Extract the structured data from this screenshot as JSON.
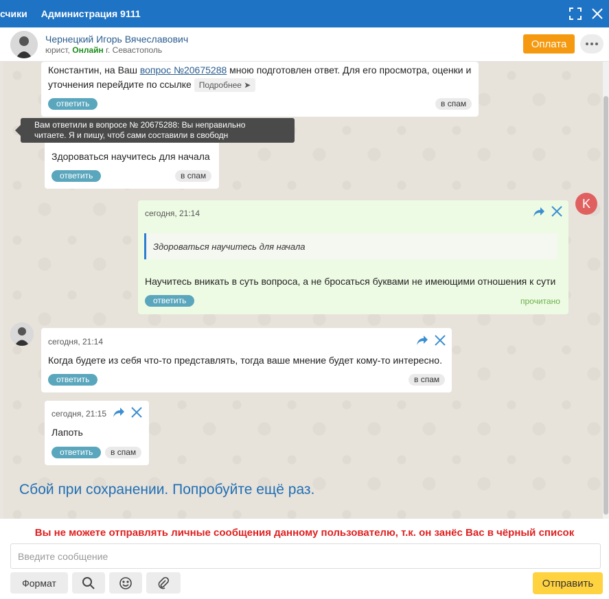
{
  "window": {
    "tabs": [
      "счики",
      "Администрация 9111"
    ]
  },
  "header": {
    "user_name": "Чернецкий Игорь Вячеславович",
    "role": "юрист,",
    "status": "Онлайн",
    "city": "г. Севастополь",
    "pay_label": "Оплата"
  },
  "messages": {
    "m1": {
      "text_before": "Константин, на Ваш ",
      "link": "вопрос №20675288",
      "text_after": " мною подготовлен ответ. Для его просмотра, оценки и уточнения перейдите по ссылке ",
      "more": "Подробнее ➤",
      "reply": "ответить",
      "spam": "в спам"
    },
    "tooltip": {
      "line1": "Вам ответили в вопросе № 20675288: Вы неправильно",
      "line2": "читаете. Я и пишу, чтоб сами составили в свободн"
    },
    "m2": {
      "text": "Здороваться научитесь для начала",
      "reply": "ответить",
      "spam": "в спам"
    },
    "m3": {
      "time": "сегодня, 21:14",
      "quote": "Здороваться научитесь для начала",
      "text": "Научитесь вникать в суть вопроса, а не бросаться буквами не имеющими отношения к сути",
      "reply": "ответить",
      "read": "прочитано",
      "avatar_letter": "K"
    },
    "m4": {
      "time": "сегодня, 21:14",
      "text": "Когда будете из себя что-то представлять, тогда ваше мнение будет кому-то интересно.",
      "reply": "ответить",
      "spam": "в спам"
    },
    "m5": {
      "time": "сегодня, 21:15",
      "text": "Лапоть",
      "reply": "ответить",
      "spam": "в спам"
    }
  },
  "error": "Сбой при сохранении. Попробуйте ещё раз.",
  "composer": {
    "blocked_notice": "Вы не можете отправлять личные сообщения данному пользователю, т.к. он занёс Вас в чёрный список",
    "placeholder": "Введите сообщение",
    "format_label": "Формат",
    "send_label": "Отправить"
  },
  "colors": {
    "topbar": "#1e73c4",
    "pay": "#f59a10",
    "send": "#ffd23f",
    "reply": "#5aa6bd",
    "blocked": "#e02020"
  }
}
